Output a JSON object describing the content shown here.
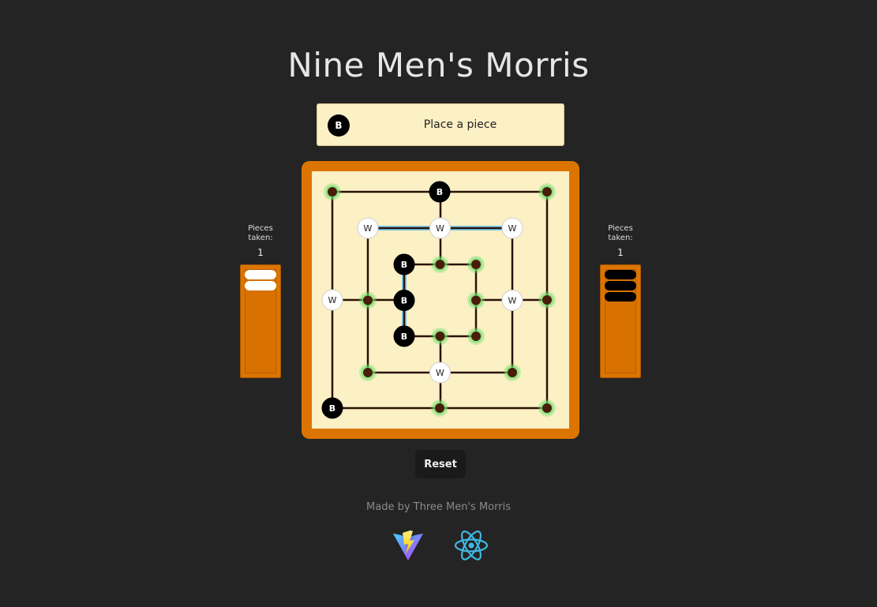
{
  "title": "Nine Men's Morris",
  "status": {
    "turn": "B",
    "message": "Place a piece"
  },
  "left_panel": {
    "label": "Pieces taken:",
    "count": "1",
    "pieces": [
      "white",
      "white"
    ]
  },
  "right_panel": {
    "label": "Pieces taken:",
    "count": "1",
    "pieces": [
      "black",
      "black",
      "black"
    ]
  },
  "board": {
    "pieces": [
      {
        "pos": "r0-0",
        "player": "empty"
      },
      {
        "pos": "r0-1",
        "player": "B"
      },
      {
        "pos": "r0-2",
        "player": "empty"
      },
      {
        "pos": "r0-3",
        "player": "empty"
      },
      {
        "pos": "r0-4",
        "player": "empty"
      },
      {
        "pos": "r0-5",
        "player": "empty"
      },
      {
        "pos": "r0-6",
        "player": "B"
      },
      {
        "pos": "r0-7",
        "player": "W"
      },
      {
        "pos": "r1-0",
        "player": "W"
      },
      {
        "pos": "r1-1",
        "player": "W"
      },
      {
        "pos": "r1-2",
        "player": "W"
      },
      {
        "pos": "r1-3",
        "player": "W"
      },
      {
        "pos": "r1-4",
        "player": "empty"
      },
      {
        "pos": "r1-5",
        "player": "W"
      },
      {
        "pos": "r1-6",
        "player": "empty"
      },
      {
        "pos": "r1-7",
        "player": "empty"
      },
      {
        "pos": "r2-0",
        "player": "B"
      },
      {
        "pos": "r2-1",
        "player": "empty"
      },
      {
        "pos": "r2-2",
        "player": "empty"
      },
      {
        "pos": "r2-3",
        "player": "empty"
      },
      {
        "pos": "r2-4",
        "player": "empty"
      },
      {
        "pos": "r2-5",
        "player": "empty"
      },
      {
        "pos": "r2-6",
        "player": "B"
      },
      {
        "pos": "r2-7",
        "player": "B"
      }
    ],
    "mills": [
      [
        "r1-0",
        "r1-1",
        "r1-2"
      ],
      [
        "r2-0",
        "r2-7",
        "r2-6"
      ]
    ],
    "highlighted_empty": true
  },
  "reset_label": "Reset",
  "credit": "Made by Three Men's Morris",
  "logos": [
    "vite-logo",
    "react-logo"
  ],
  "colors": {
    "background": "#242424",
    "board_frame": "#dc7400",
    "board_fill": "#fcf0c5",
    "empty_point": "#4a1d0a",
    "empty_glow": "#6ee06e",
    "mill_line": "#7cc9ef"
  }
}
